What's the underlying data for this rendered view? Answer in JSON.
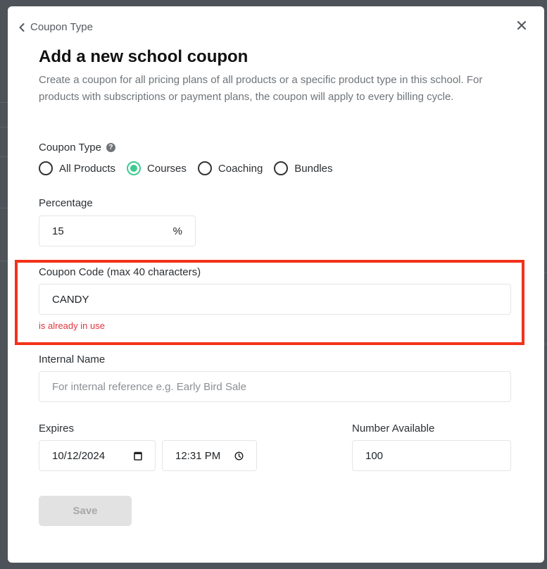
{
  "modal": {
    "back_link": "Coupon Type",
    "title": "Add a new school coupon",
    "description": "Create a coupon for all pricing plans of all products or a specific product type in this school. For products with subscriptions or payment plans, the coupon will apply to every billing cycle.",
    "close_icon": "close-icon"
  },
  "coupon_type": {
    "label": "Coupon Type",
    "help_icon": "?",
    "options": [
      {
        "label": "All Products",
        "checked": false
      },
      {
        "label": "Courses",
        "checked": true
      },
      {
        "label": "Coaching",
        "checked": false
      },
      {
        "label": "Bundles",
        "checked": false
      }
    ],
    "accent_color": "#3fca91"
  },
  "percentage": {
    "label": "Percentage",
    "value": "15",
    "suffix": "%"
  },
  "coupon_code": {
    "label": "Coupon Code (max 40 characters)",
    "value": "CANDY",
    "error": "is already in use",
    "error_color": "#e0353f",
    "highlight_color": "#f3321b"
  },
  "internal_name": {
    "label": "Internal Name",
    "value": "",
    "placeholder": "For internal reference e.g. Early Bird Sale"
  },
  "expires": {
    "label": "Expires",
    "date": "10/12/2024",
    "time": "12:31 PM"
  },
  "number_available": {
    "label": "Number Available",
    "value": "100"
  },
  "save_button": {
    "label": "Save",
    "disabled": true
  }
}
